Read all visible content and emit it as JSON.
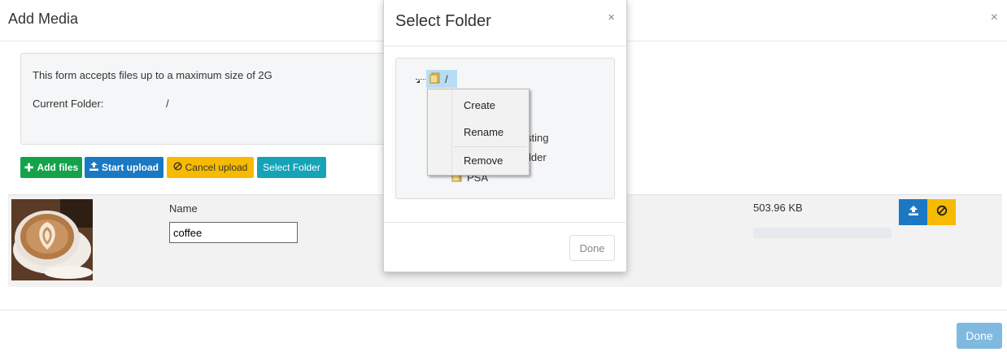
{
  "main": {
    "title": "Add Media",
    "close_glyph": "×",
    "info_text": "This form accepts files up to a maximum size of 2G",
    "current_folder_label": "Current Folder:",
    "current_folder_value": "/",
    "buttons": {
      "add_files": "Add files",
      "start_upload": "Start upload",
      "cancel_upload": "Cancel upload",
      "select_folder": "Select Folder"
    },
    "file": {
      "name_label": "Name",
      "name_value": "coffee",
      "size": "503.96 KB",
      "progress": 0
    },
    "done_label": "Done"
  },
  "dialog": {
    "title": "Select Folder",
    "close_glyph": "×",
    "tree": {
      "root_label": "/",
      "visible_fragments": [
        "sting",
        "lder",
        "PSA"
      ]
    },
    "done_label": "Done"
  },
  "context_menu": {
    "items": [
      "Create",
      "Rename",
      "Remove"
    ]
  },
  "colors": {
    "add_files": "#14a34a",
    "start_upload": "#1b78c2",
    "cancel_upload": "#f6bb00",
    "select_folder": "#15a3b8",
    "done_primary_disabled": "#7fb9e0",
    "tree_selected": "#b8ddf3"
  },
  "icons": [
    "plus-icon",
    "upload-icon",
    "cancel-icon",
    "folder-icon",
    "close-icon"
  ]
}
